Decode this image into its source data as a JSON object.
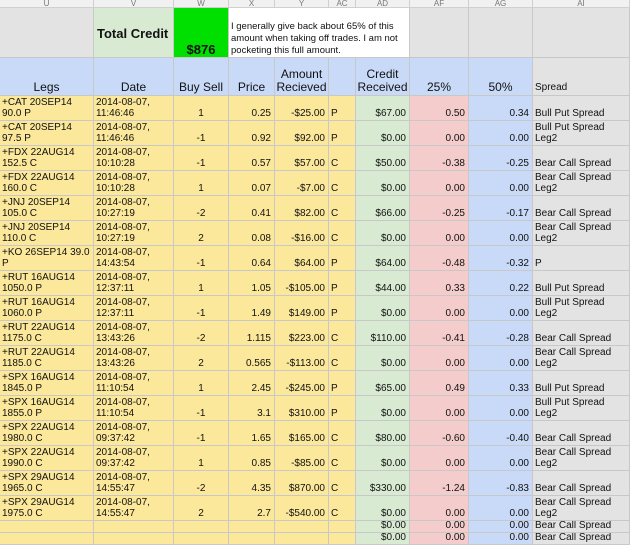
{
  "columns": [
    "U",
    "V",
    "W",
    "X",
    "Y",
    "AC",
    "AD",
    "AF",
    "AG",
    "AI"
  ],
  "top": {
    "total_label": "Total Credit",
    "total_value": "$876",
    "note": "I generally give back about 65% of this amount when taking off trades. I am not pocketing this full amount."
  },
  "headers": {
    "legs": "Legs",
    "date": "Date",
    "buy_sell": "Buy Sell",
    "price": "Price",
    "amount": "Amount Recieved",
    "credit": "Credit Received",
    "pct25": "25%",
    "pct50": "50%",
    "spread": "Spread"
  },
  "rows": [
    {
      "leg": "+CAT 20SEP14 90.0 P",
      "date": "2014-08-07, 11:46:46",
      "qty": "1",
      "price": "0.25",
      "amount": "-$25.00",
      "type": "P",
      "credit": "$67.00",
      "p25": "0.50",
      "p50": "0.34",
      "spread": "Bull Put Spread"
    },
    {
      "leg": "+CAT 20SEP14 97.5 P",
      "date": "2014-08-07, 11:46:46",
      "qty": "-1",
      "price": "0.92",
      "amount": "$92.00",
      "type": "P",
      "credit": "$0.00",
      "p25": "0.00",
      "p50": "0.00",
      "spread": "Bull Put Spread Leg2"
    },
    {
      "leg": "+FDX 22AUG14 152.5 C",
      "date": "2014-08-07, 10:10:28",
      "qty": "-1",
      "price": "0.57",
      "amount": "$57.00",
      "type": "C",
      "credit": "$50.00",
      "p25": "-0.38",
      "p50": "-0.25",
      "spread": "Bear Call Spread"
    },
    {
      "leg": "+FDX 22AUG14 160.0 C",
      "date": "2014-08-07, 10:10:28",
      "qty": "1",
      "price": "0.07",
      "amount": "-$7.00",
      "type": "C",
      "credit": "$0.00",
      "p25": "0.00",
      "p50": "0.00",
      "spread": "Bear Call Spread Leg2"
    },
    {
      "leg": "+JNJ 20SEP14 105.0 C",
      "date": "2014-08-07, 10:27:19",
      "qty": "-2",
      "price": "0.41",
      "amount": "$82.00",
      "type": "C",
      "credit": "$66.00",
      "p25": "-0.25",
      "p50": "-0.17",
      "spread": "Bear Call Spread"
    },
    {
      "leg": "+JNJ 20SEP14 110.0 C",
      "date": "2014-08-07, 10:27:19",
      "qty": "2",
      "price": "0.08",
      "amount": "-$16.00",
      "type": "C",
      "credit": "$0.00",
      "p25": "0.00",
      "p50": "0.00",
      "spread": "Bear Call Spread Leg2"
    },
    {
      "leg": "+KO 26SEP14 39.0 P",
      "date": "2014-08-07, 14:43:54",
      "qty": "-1",
      "price": "0.64",
      "amount": "$64.00",
      "type": "P",
      "credit": "$64.00",
      "p25": "-0.48",
      "p50": "-0.32",
      "spread": "P"
    },
    {
      "leg": "+RUT 16AUG14 1050.0 P",
      "date": "2014-08-07, 12:37:11",
      "qty": "1",
      "price": "1.05",
      "amount": "-$105.00",
      "type": "P",
      "credit": "$44.00",
      "p25": "0.33",
      "p50": "0.22",
      "spread": "Bull Put Spread"
    },
    {
      "leg": "+RUT 16AUG14 1060.0 P",
      "date": "2014-08-07, 12:37:11",
      "qty": "-1",
      "price": "1.49",
      "amount": "$149.00",
      "type": "P",
      "credit": "$0.00",
      "p25": "0.00",
      "p50": "0.00",
      "spread": "Bull Put Spread Leg2"
    },
    {
      "leg": "+RUT 22AUG14 1175.0 C",
      "date": "2014-08-07, 13:43:26",
      "qty": "-2",
      "price": "1.115",
      "amount": "$223.00",
      "type": "C",
      "credit": "$110.00",
      "p25": "-0.41",
      "p50": "-0.28",
      "spread": "Bear Call Spread"
    },
    {
      "leg": "+RUT 22AUG14 1185.0 C",
      "date": "2014-08-07, 13:43:26",
      "qty": "2",
      "price": "0.565",
      "amount": "-$113.00",
      "type": "C",
      "credit": "$0.00",
      "p25": "0.00",
      "p50": "0.00",
      "spread": "Bear Call Spread Leg2"
    },
    {
      "leg": "+SPX 16AUG14 1845.0 P",
      "date": "2014-08-07, 11:10:54",
      "qty": "1",
      "price": "2.45",
      "amount": "-$245.00",
      "type": "P",
      "credit": "$65.00",
      "p25": "0.49",
      "p50": "0.33",
      "spread": "Bull Put Spread"
    },
    {
      "leg": "+SPX 16AUG14 1855.0 P",
      "date": "2014-08-07, 11:10:54",
      "qty": "-1",
      "price": "3.1",
      "amount": "$310.00",
      "type": "P",
      "credit": "$0.00",
      "p25": "0.00",
      "p50": "0.00",
      "spread": "Bull Put Spread Leg2"
    },
    {
      "leg": "+SPX 22AUG14 1980.0 C",
      "date": "2014-08-07, 09:37:42",
      "qty": "-1",
      "price": "1.65",
      "amount": "$165.00",
      "type": "C",
      "credit": "$80.00",
      "p25": "-0.60",
      "p50": "-0.40",
      "spread": "Bear Call Spread"
    },
    {
      "leg": "+SPX 22AUG14 1990.0 C",
      "date": "2014-08-07, 09:37:42",
      "qty": "1",
      "price": "0.85",
      "amount": "-$85.00",
      "type": "C",
      "credit": "$0.00",
      "p25": "0.00",
      "p50": "0.00",
      "spread": "Bear Call Spread Leg2"
    },
    {
      "leg": "+SPX 29AUG14 1965.0 C",
      "date": "2014-08-07, 14:55:47",
      "qty": "-2",
      "price": "4.35",
      "amount": "$870.00",
      "type": "C",
      "credit": "$330.00",
      "p25": "-1.24",
      "p50": "-0.83",
      "spread": "Bear Call Spread"
    },
    {
      "leg": "+SPX 29AUG14 1975.0 C",
      "date": "2014-08-07, 14:55:47",
      "qty": "2",
      "price": "2.7",
      "amount": "-$540.00",
      "type": "C",
      "credit": "$0.00",
      "p25": "0.00",
      "p50": "0.00",
      "spread": "Bear Call Spread Leg2"
    },
    {
      "leg": "",
      "date": "",
      "qty": "",
      "price": "",
      "amount": "",
      "type": "",
      "credit": "$0.00",
      "p25": "0.00",
      "p50": "0.00",
      "spread": "Bear Call Spread"
    },
    {
      "leg": "",
      "date": "",
      "qty": "",
      "price": "",
      "amount": "",
      "type": "",
      "credit": "$0.00",
      "p25": "0.00",
      "p50": "0.00",
      "spread": "Bear Call Spread"
    }
  ],
  "colors": {
    "yellow": "#fce89a",
    "green": "#d9ead3",
    "pink": "#f4cccc",
    "blue": "#c9daf8",
    "gray": "#e3e3e3",
    "bright_green": "#00e000"
  }
}
